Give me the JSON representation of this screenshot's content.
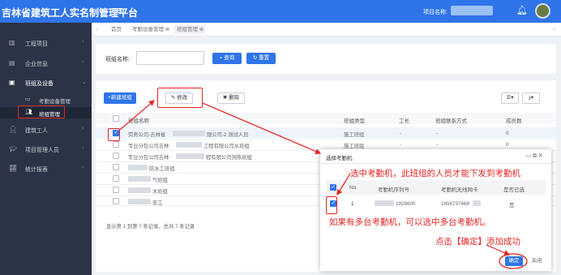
{
  "header": {
    "title": "吉林省建筑工人实名制管理平台",
    "menu_icon": "hamburger-icon",
    "project_label": "项目名称:",
    "notification_icon": "bell-icon"
  },
  "sidebar": {
    "items": [
      {
        "label": "工程项目",
        "icon": "building-icon"
      },
      {
        "label": "企业信息",
        "icon": "enterprise-icon"
      },
      {
        "label": "班组及设备",
        "icon": "device-icon"
      },
      {
        "label": "建筑工人",
        "icon": "worker-icon"
      },
      {
        "label": "项目管理人员",
        "icon": "manager-icon"
      },
      {
        "label": "统计报表",
        "icon": "chart-icon"
      }
    ],
    "subitems": [
      {
        "label": "考勤设备管理",
        "icon": "attendance-device-icon"
      },
      {
        "label": "班组管理",
        "icon": "team-icon"
      }
    ]
  },
  "tabs": [
    {
      "label": "首页"
    },
    {
      "label": "考勤设备管理 ⊗"
    },
    {
      "label": "班组管理 ⊗"
    }
  ],
  "search": {
    "label": "班组名称:",
    "query_button": "查询",
    "reset_button": "重置"
  },
  "toolbar": {
    "add_button": "+新建班组",
    "edit_button": "修改",
    "delete_button": "✖ 删除"
  },
  "table": {
    "columns": [
      "班组名称",
      "班组类型",
      "工长",
      "班组联系方式",
      "成员数"
    ],
    "rows": [
      {
        "name_prefix": "劳务公司-吉林省",
        "name_suffix": "限公司-2.测试人员",
        "type": "施工班组",
        "leader": "-",
        "contact": "-",
        "members": "0"
      },
      {
        "name_prefix": "专业分包公司吉林",
        "name_suffix": "工程有限公司水班组",
        "type": "施工班组",
        "leader": "-",
        "contact": "-",
        "members": "0"
      },
      {
        "name_prefix": "专业分包公司吉林",
        "name_suffix": "程有限公司测热班组",
        "type": "施工班组",
        "leader": "-",
        "contact": "-",
        "members": "0"
      },
      {
        "name_prefix": "",
        "name_suffix": "防水工班组",
        "type": "",
        "leader": "",
        "contact": "",
        "members": ""
      },
      {
        "name_prefix": "",
        "name_suffix": "气班组",
        "type": "",
        "leader": "",
        "contact": "",
        "members": ""
      },
      {
        "name_prefix": "",
        "name_suffix": "木班组",
        "type": "",
        "leader": "",
        "contact": "",
        "members": ""
      },
      {
        "name_prefix": "",
        "name_suffix": "安工",
        "type": "",
        "leader": "",
        "contact": "",
        "members": ""
      }
    ],
    "footer": "显示第 1 到第 7 条记录，总共 7 条记录"
  },
  "modal": {
    "title": "选择考勤机",
    "columns": [
      "No",
      "考勤机序列号",
      "考勤机无线网卡",
      "是否已选"
    ],
    "rows": [
      {
        "no": "1",
        "serial": "1928600",
        "mac": "1656737468",
        "selected": "是"
      }
    ],
    "ok_button": "确定",
    "close_button": "关闭",
    "window_controls": "— ⧉ ✕"
  },
  "annotations": {
    "select_device": "选中考勤机，此班组的人员才能下发到考勤机",
    "multi_device": "如果有多台考勤机，可以选中多台考勤机。",
    "click_confirm": "点击【确定】添加成功"
  },
  "colors": {
    "primary": "#2f74e8",
    "sidebar": "#2b3446",
    "annotation": "#e82424"
  }
}
